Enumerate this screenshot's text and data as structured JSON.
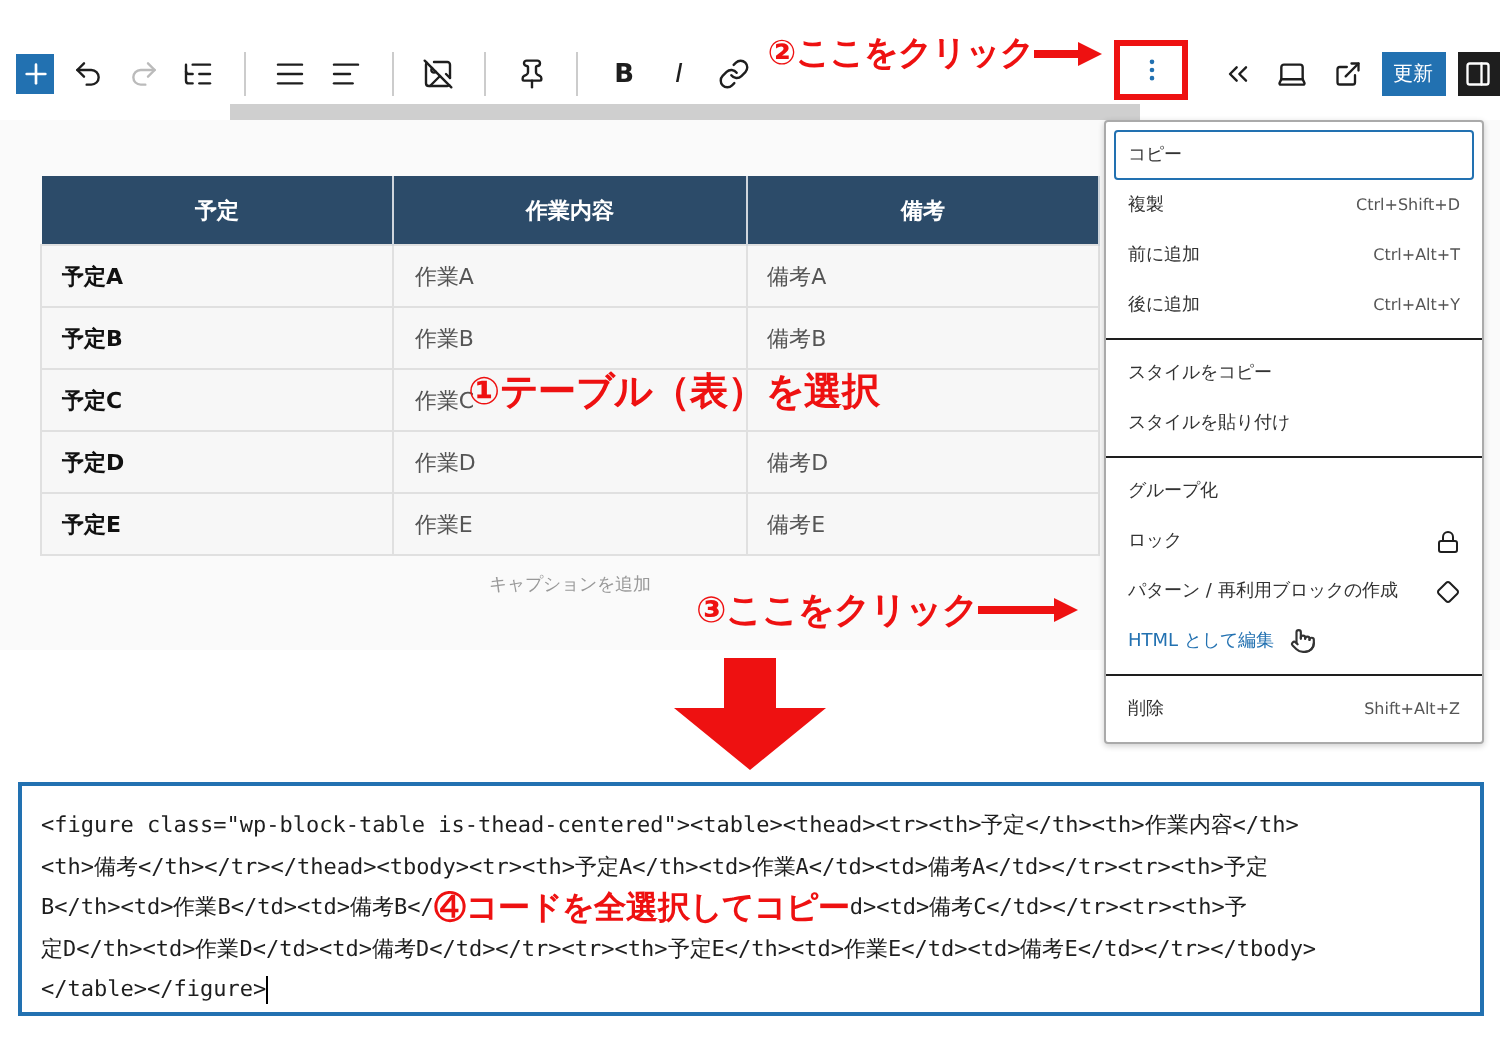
{
  "toolbar": {
    "format_labels": [
      "B",
      "I"
    ],
    "callout": "②ここをクリック",
    "update_button": "更新"
  },
  "table": {
    "columns": [
      "予定",
      "作業内容",
      "備考"
    ],
    "rows": [
      [
        "予定A",
        "作業A",
        "備考A"
      ],
      [
        "予定B",
        "作業B",
        "備考B"
      ],
      [
        "予定C",
        "作業C"
      ],
      [
        "予定D",
        "作業D",
        "備考D"
      ],
      [
        "予定E",
        "作業E",
        "備考E"
      ]
    ],
    "caption_placeholder": "キャプションを追加",
    "callout": "①テーブル（表）を選択"
  },
  "menu": {
    "callout": "③ここをクリック",
    "groups": [
      [
        {
          "label": "コピー",
          "kind": "plain",
          "selected": true,
          "hovered": false
        },
        {
          "label": "複製",
          "kind": "shortcut",
          "shortcut": "Ctrl+Shift+D",
          "selected": false,
          "hovered": false
        },
        {
          "label": "前に追加",
          "kind": "shortcut",
          "shortcut": "Ctrl+Alt+T",
          "selected": false,
          "hovered": false
        },
        {
          "label": "後に追加",
          "kind": "shortcut",
          "shortcut": "Ctrl+Alt+Y",
          "selected": false,
          "hovered": false
        }
      ],
      [
        {
          "label": "スタイルをコピー",
          "kind": "plain",
          "selected": false,
          "hovered": false
        },
        {
          "label": "スタイルを貼り付け",
          "kind": "plain",
          "selected": false,
          "hovered": false
        }
      ],
      [
        {
          "label": "グループ化",
          "kind": "plain",
          "selected": false,
          "hovered": false
        },
        {
          "label": "ロック",
          "kind": "lock",
          "selected": false,
          "hovered": false
        },
        {
          "label": "パターン / 再利用ブロックの作成",
          "kind": "pattern",
          "selected": false,
          "hovered": false
        },
        {
          "label": "HTML として編集",
          "kind": "plain",
          "selected": false,
          "hovered": true
        }
      ],
      [
        {
          "label": "削除",
          "kind": "shortcut",
          "shortcut": "Shift+Alt+Z",
          "selected": false,
          "hovered": false
        }
      ]
    ]
  },
  "code_editor": {
    "lines": [
      {
        "kind": "text",
        "text": "<figure class=\"wp-block-table is-thead-centered\"><table><thead><tr><th>予定</th><th>作業内容</th>"
      },
      {
        "kind": "text",
        "text": "<th>備考</th></tr></thead><tbody><tr><th>予定A</th><td>作業A</td><td>備考A</td></tr><tr><th>予定"
      },
      {
        "kind": "callout",
        "before": "B</th><td>作業B</td><td>備考B</",
        "callout": "④コードを全選択してコピー",
        "after": "d><td>備考C</td></tr><tr><th>予"
      },
      {
        "kind": "text",
        "text": "定D</th><td>作業D</td><td>備考D</td></tr><tr><th>予定E</th><td>作業E</td><td>備考E</td></tr></tbody>"
      },
      {
        "kind": "text",
        "text": "</table></figure>",
        "caret": true
      }
    ]
  }
}
